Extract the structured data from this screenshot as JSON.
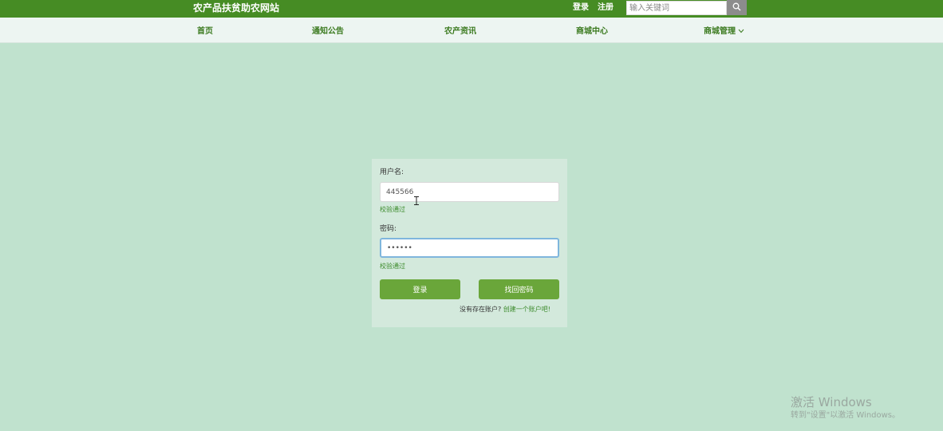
{
  "header": {
    "site_title": "农产品扶贫助农网站",
    "login_link": "登录",
    "register_link": "注册",
    "search_placeholder": "输入关键词",
    "search_icon": "search-icon"
  },
  "nav": {
    "items": [
      {
        "label": "首页"
      },
      {
        "label": "通知公告"
      },
      {
        "label": "农产资讯"
      },
      {
        "label": "商城中心"
      },
      {
        "label": "商城管理",
        "icon": "chevron-down-icon"
      }
    ]
  },
  "login": {
    "username_label": "用户名:",
    "username_value": "445566",
    "username_hint": "校验通过",
    "password_label": "密码:",
    "password_value": "••••••",
    "password_hint": "校验通过",
    "login_button": "登录",
    "recover_button": "找回密码",
    "no_account_text": "没有存在账户?",
    "create_account_link": "创建一个账户吧!"
  },
  "watermark": {
    "title": "激活 Windows",
    "subtitle": "转到\"设置\"以激活 Windows。"
  },
  "colors": {
    "topbar": "#468c24",
    "background": "#c0e2ce",
    "panel": "#d3e9dc",
    "button": "#6aa63a",
    "nav_text": "#3b7a1f"
  }
}
